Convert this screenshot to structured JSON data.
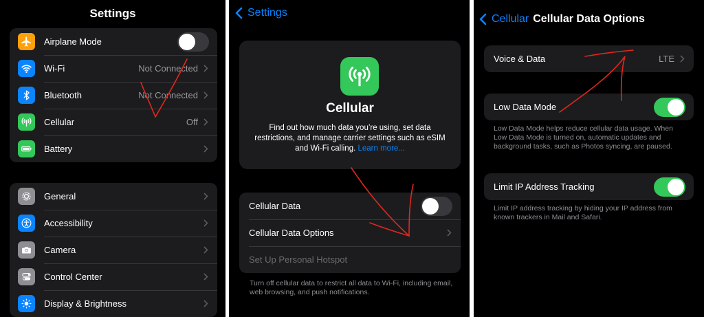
{
  "panel1": {
    "title": "Settings",
    "group1": [
      {
        "label": "Airplane Mode",
        "icon": "airplane-icon",
        "color": "#ff9f0a",
        "toggle": false
      },
      {
        "label": "Wi-Fi",
        "icon": "wifi-icon",
        "color": "#0a84ff",
        "value": "Not Connected"
      },
      {
        "label": "Bluetooth",
        "icon": "bluetooth-icon",
        "color": "#0a84ff",
        "value": "Not Connected"
      },
      {
        "label": "Cellular",
        "icon": "cellular-antenna-icon",
        "color": "#34c759",
        "value": "Off"
      },
      {
        "label": "Battery",
        "icon": "battery-icon",
        "color": "#34c759"
      }
    ],
    "group2": [
      {
        "label": "General",
        "icon": "gear-icon",
        "color": "#8e8e93"
      },
      {
        "label": "Accessibility",
        "icon": "accessibility-icon",
        "color": "#0a84ff"
      },
      {
        "label": "Camera",
        "icon": "camera-icon",
        "color": "#8e8e93"
      },
      {
        "label": "Control Center",
        "icon": "toggles-icon",
        "color": "#8e8e93"
      },
      {
        "label": "Display & Brightness",
        "icon": "brightness-icon",
        "color": "#0a84ff"
      }
    ]
  },
  "panel2": {
    "back_label": "Settings",
    "card": {
      "icon": "cellular-antenna-icon",
      "title": "Cellular",
      "description": "Find out how much data you’re using, set data restrictions, and manage carrier settings such as eSIM and Wi-Fi calling.",
      "link": "Learn more..."
    },
    "rows": {
      "cellular_data": "Cellular Data",
      "cellular_data_on": false,
      "options": "Cellular Data Options",
      "hotspot": "Set Up Personal Hotspot"
    },
    "footer": "Turn off cellular data to restrict all data to Wi-Fi, including email, web browsing, and push notifications."
  },
  "panel3": {
    "back_label": "Cellular",
    "title": "Cellular Data Options",
    "voice_data": {
      "label": "Voice & Data",
      "value": "LTE"
    },
    "low_data": {
      "label": "Low Data Mode",
      "on": true,
      "footer": "Low Data Mode helps reduce cellular data usage. When Low Data Mode is turned on, automatic updates and background tasks, such as Photos syncing, are paused."
    },
    "limit_ip": {
      "label": "Limit IP Address Tracking",
      "on": true,
      "footer": "Limit IP address tracking by hiding your IP address from known trackers in Mail and Safari."
    }
  },
  "colors": {
    "accent": "#0a84ff",
    "toggle_on": "#34c759",
    "annotation": "#e0281e"
  }
}
